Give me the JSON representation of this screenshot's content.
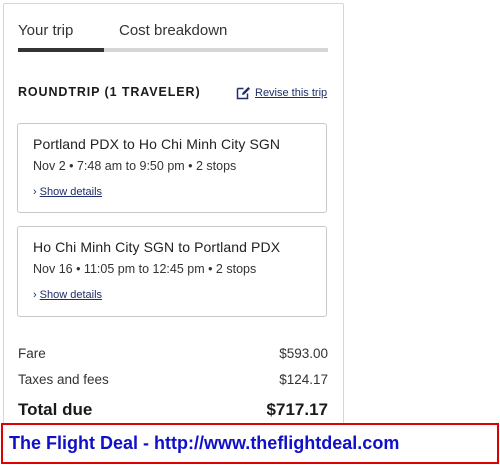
{
  "tabs": [
    {
      "label": "Your trip",
      "active": true
    },
    {
      "label": "Cost breakdown",
      "active": false
    }
  ],
  "trip": {
    "title": "ROUNDTRIP (1 TRAVELER)",
    "revise_label": "Revise this trip",
    "revise_icon": "edit-icon"
  },
  "flights": [
    {
      "route": "Portland PDX to Ho Chi Minh City SGN",
      "schedule": "Nov 2 • 7:48 am to 9:50 pm • 2 stops",
      "details_label": "Show details"
    },
    {
      "route": "Ho Chi Minh City SGN to Portland PDX",
      "schedule": "Nov 16 • 11:05 pm to 12:45 pm • 2 stops",
      "details_label": "Show details"
    }
  ],
  "cost": {
    "fare_label": "Fare",
    "fare_value": "$593.00",
    "taxes_label": "Taxes and fees",
    "taxes_value": "$124.17",
    "total_label": "Total due",
    "total_value": "$717.17"
  },
  "banner": {
    "text": "The Flight Deal - http://www.theflightdeal.com"
  },
  "colors": {
    "link": "#1e2e6b",
    "banner_border": "#e00000",
    "banner_text": "#1010c8"
  }
}
